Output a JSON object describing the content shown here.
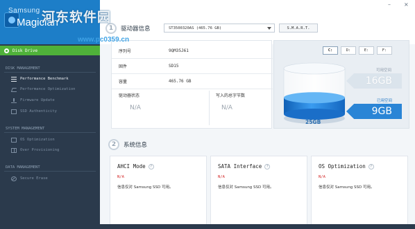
{
  "app": {
    "brand_top": "Samsung",
    "brand_name": "Magician",
    "watermark": "河东软件园",
    "watermark_url": "www.pc0359.cn"
  },
  "window": {
    "minimize": "–",
    "close": "×"
  },
  "sidebar": {
    "active_item": "Disk Drive",
    "sections": [
      {
        "title": "DISK MANAGEMENT",
        "items": [
          {
            "label": "Performance Benchmark",
            "icon": "benchmark-icon"
          },
          {
            "label": "Performance Optimization",
            "icon": "optimization-icon"
          },
          {
            "label": "Firmware Update",
            "icon": "download-icon"
          },
          {
            "label": "SSD Authenticity",
            "icon": "authenticity-icon"
          }
        ]
      },
      {
        "title": "SYSTEM MANAGEMENT",
        "items": [
          {
            "label": "OS Optimization",
            "icon": "os-icon"
          },
          {
            "label": "Over Provisioning",
            "icon": "provisioning-icon"
          }
        ]
      },
      {
        "title": "DATA MANAGEMENT",
        "items": [
          {
            "label": "Secure Erase",
            "icon": "erase-icon"
          }
        ]
      }
    ]
  },
  "drive": {
    "step": "1",
    "title": "驱动器信息",
    "selected": "ST3500320AS   (465.76 GB)",
    "smart_button": "S.M.A.R.T.",
    "fields": [
      {
        "label": "序列号",
        "value": "9QM35J61"
      },
      {
        "label": "固件",
        "value": "SD15"
      },
      {
        "label": "容量",
        "value": "465.76 GB"
      }
    ],
    "status_label": "驱动器状态",
    "status_value": "N/A",
    "tbw_label": "写入的总字节数",
    "tbw_value": "N/A"
  },
  "capacity": {
    "letters": [
      "C:",
      "D:",
      "E:",
      "F:"
    ],
    "active_letter": "C:",
    "total": "25GB",
    "free_label": "可用空间",
    "free_value": "16GB",
    "used_label": "已用空间",
    "used_value": "9GB",
    "used_fraction": 0.36,
    "colors": {
      "used": "#2a85d6",
      "free": "#dbe4ec"
    }
  },
  "system": {
    "step": "2",
    "title": "系统信息",
    "cards": [
      {
        "title": "AHCI Mode",
        "status": "N/A",
        "note": "信息仅对 Samsung SSD 可用。"
      },
      {
        "title": "SATA Interface",
        "status": "N/A",
        "note": "信息仅对 Samsung SSD 可用。"
      },
      {
        "title": "OS Optimization",
        "status": "N/A",
        "note": "信息仅对 Samsung SSD 可用。"
      }
    ]
  }
}
